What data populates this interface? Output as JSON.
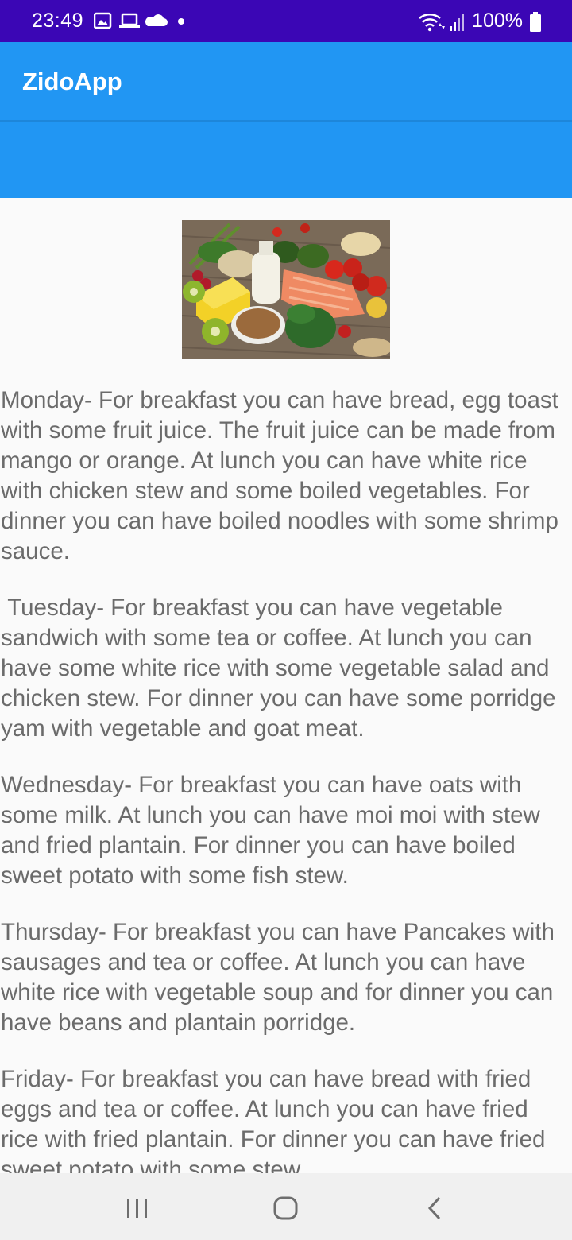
{
  "status_bar": {
    "time": "23:49",
    "battery": "100%",
    "icons": [
      "image-icon",
      "laptop-icon",
      "cloud-icon",
      "dot-icon",
      "wifi-icon",
      "signal-icon",
      "battery-icon"
    ]
  },
  "app_bar": {
    "title": "ZidoApp"
  },
  "content": {
    "image": "food-image",
    "paragraphs": [
      "Monday- For breakfast you can have bread, egg toast with some fruit juice. The fruit juice can be made from mango or orange. At lunch you can have white rice with chicken stew and some boiled vegetables. For dinner you can have boiled noodles with some shrimp sauce.",
      " Tuesday- For breakfast you can have vegetable sandwich with some tea or coffee. At lunch you can have some white rice with some vegetable salad and chicken stew. For dinner you can have some porridge yam with vegetable and goat meat.",
      "Wednesday- For breakfast you can have oats with some milk. At lunch you can have moi moi with stew and fried plantain. For dinner you can have boiled sweet potato with some fish stew.",
      "Thursday- For breakfast you can have Pancakes with sausages and tea or coffee. At lunch you can have white rice with vegetable soup and for dinner you can have beans and plantain porridge.",
      "Friday- For breakfast you can have bread with fried eggs and tea or coffee. At lunch you can have fried rice with fried plantain. For dinner you can have fried sweet potato with some stew."
    ]
  },
  "colors": {
    "status_bar": "#3b06b5",
    "app_bar": "#2196f3",
    "text": "#6b6b6b",
    "background": "#fafafa"
  }
}
